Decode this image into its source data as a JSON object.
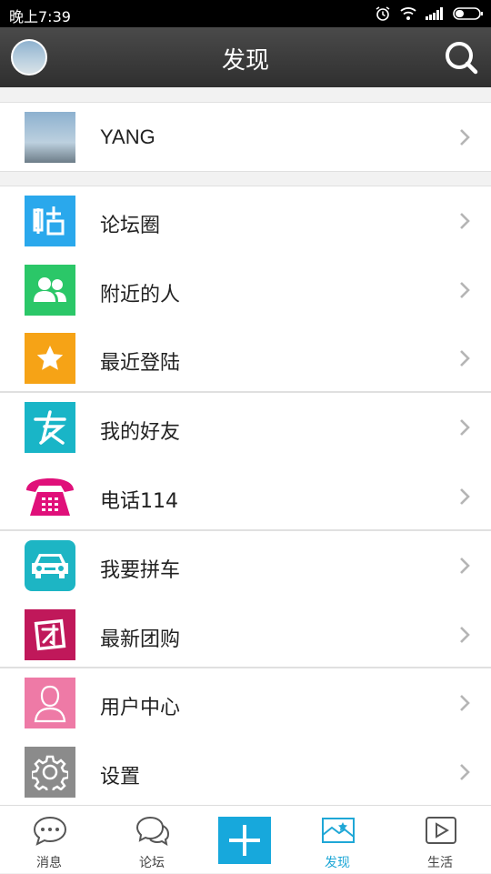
{
  "status_bar": {
    "time": "晚上7:39"
  },
  "header": {
    "title": "发现"
  },
  "profile": {
    "name": "YANG"
  },
  "menu": [
    {
      "label": "论坛圈",
      "icon": "forum-post-icon",
      "color": "#2aa8ec"
    },
    {
      "label": "附近的人",
      "icon": "people-nearby-icon",
      "color": "#2bc768"
    },
    {
      "label": "最近登陆",
      "icon": "star-icon",
      "color": "#f6a316"
    },
    {
      "label": "我的好友",
      "icon": "friends-icon",
      "color": "#19b5c7"
    },
    {
      "label": "电话114",
      "icon": "telephone-icon",
      "color": "#e0107a"
    },
    {
      "label": "我要拼车",
      "icon": "car-icon",
      "color": "#1db5c4"
    },
    {
      "label": "最新团购",
      "icon": "group-buy-icon",
      "color": "#c0185a"
    },
    {
      "label": "用户中心",
      "icon": "user-center-icon",
      "color": "#ee7aa6"
    },
    {
      "label": "设置",
      "icon": "gear-icon",
      "color": "#8b8b8b"
    }
  ],
  "tabs": [
    {
      "label": "消息",
      "icon": "message-icon"
    },
    {
      "label": "论坛",
      "icon": "forum-icon"
    },
    {
      "label": "",
      "icon": "plus-icon"
    },
    {
      "label": "发现",
      "icon": "discover-icon",
      "active": true
    },
    {
      "label": "生活",
      "icon": "life-play-icon"
    }
  ],
  "accent_color": "#17a8dc"
}
